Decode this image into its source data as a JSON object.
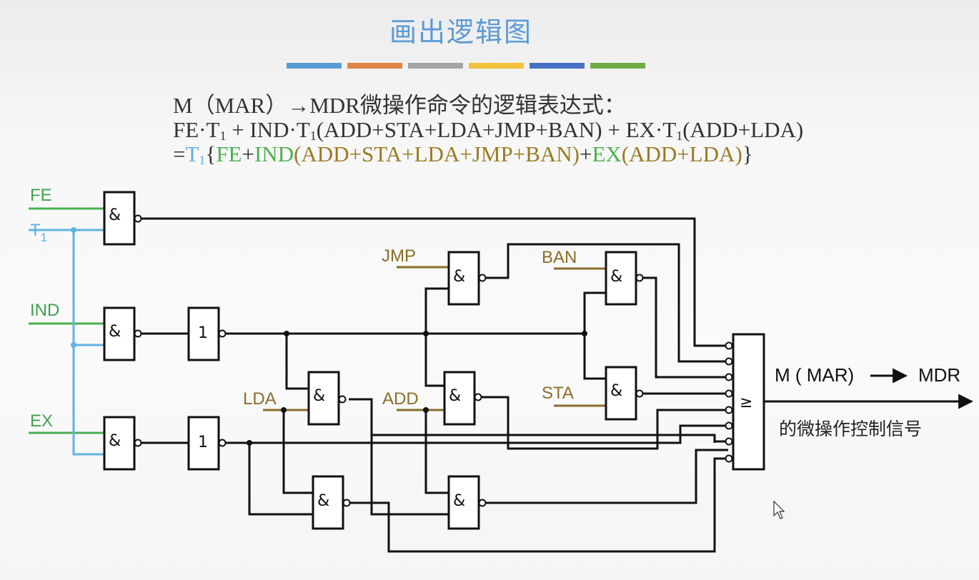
{
  "title": "画出逻辑图",
  "watermark": "",
  "accent_bars": [
    "#5b9bd5",
    "#dd8447",
    "#a5a5a5",
    "#f2c23a",
    "#4472c4",
    "#70ad47"
  ],
  "expression": {
    "line1": "M（MAR）→MDR微操作命令的逻辑表达式：",
    "line2_a": "FE·T",
    "line2_b": " + IND·T",
    "line2_c": "(ADD+STA+LDA+JMP+BAN) + EX·T",
    "line2_d": "(ADD+LDA)",
    "sub1": "1",
    "line3_eq": "=",
    "line3_t": "T",
    "line3_open": "{",
    "line3_fe": "FE",
    "line3_plus1": "+",
    "line3_ind": "IND",
    "line3_p1": "(ADD+STA+LDA+JMP+BAN)",
    "line3_plus2": "+",
    "line3_ex": "EX",
    "line3_p2": "(ADD+LDA)",
    "line3_close": "}"
  },
  "inputs": {
    "fe": "FE",
    "t1_main": "T",
    "t1_sub": "1",
    "ind": "IND",
    "ex": "EX",
    "jmp": "JMP",
    "ban": "BAN",
    "lda": "LDA",
    "add": "ADD",
    "sta": "STA"
  },
  "gates": {
    "and_symbol": "&",
    "not_symbol": "1",
    "or_symbol": "≥"
  },
  "output": {
    "label": "M ( MAR)",
    "target": "MDR",
    "caption": "的微操作控制信号"
  }
}
